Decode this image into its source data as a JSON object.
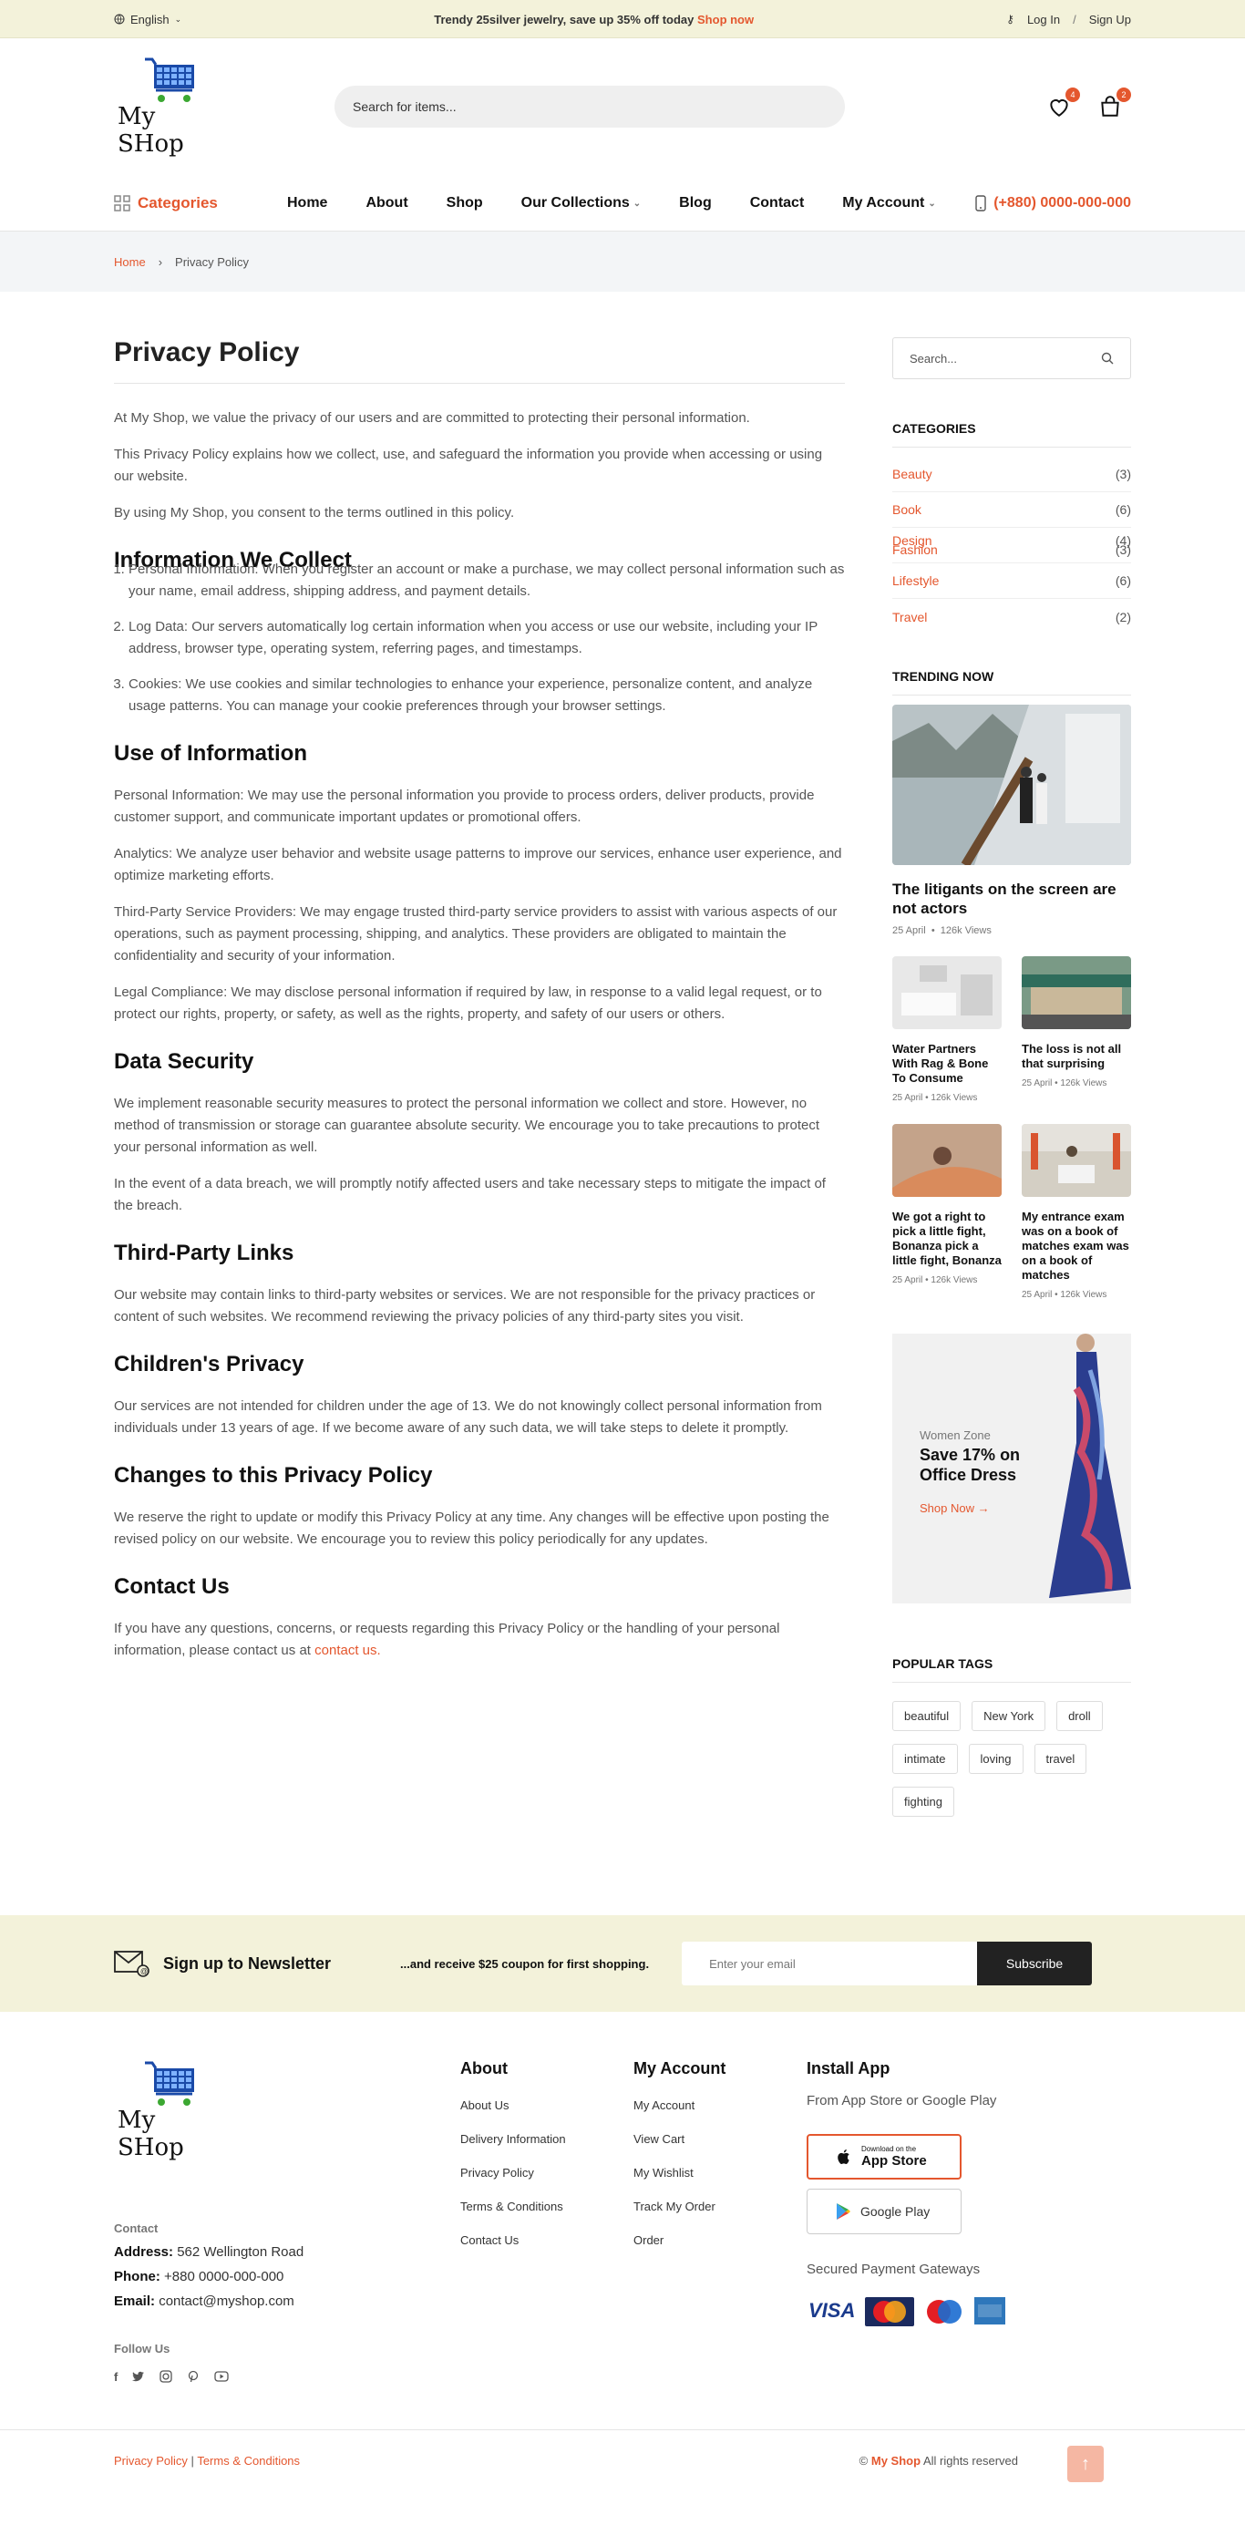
{
  "topbar": {
    "language": "English",
    "promo_text": "Trendy 25silver jewelry, save up 35% off today",
    "promo_link": "Shop now",
    "login": "Log In",
    "separator": "/",
    "signup": "Sign Up"
  },
  "header": {
    "brand": "My SHop",
    "search_placeholder": "Search for items...",
    "wishlist_count": "4",
    "cart_count": "2"
  },
  "nav": {
    "categories_label": "Categories",
    "items": [
      "Home",
      "About",
      "Shop",
      "Our Collections",
      "Blog",
      "Contact",
      "My Account"
    ],
    "phone": "(+880) 0000-000-000"
  },
  "breadcrumb": {
    "home": "Home",
    "sep": "›",
    "current": "Privacy Policy"
  },
  "content": {
    "title": "Privacy Policy",
    "intro": [
      "At My Shop, we value the privacy of our users and are committed to protecting their personal information.",
      "This Privacy Policy explains how we collect, use, and safeguard the information you provide when accessing or using our website.",
      "By using My Shop, you consent to the terms outlined in this policy."
    ],
    "collect_heading": "Information We Collect",
    "collect_items": [
      "Personal Information: When you register an account or make a purchase, we may collect personal information such as your name, email address, shipping address, and payment details.",
      "Log Data: Our servers automatically log certain information when you access or use our website, including your IP address, browser type, operating system, referring pages, and timestamps.",
      "Cookies: We use cookies and similar technologies to enhance your experience, personalize content, and analyze usage patterns. You can manage your cookie preferences through your browser settings."
    ],
    "use_heading": "Use of Information",
    "use_paras": [
      "Personal Information: We may use the personal information you provide to process orders, deliver products, provide customer support, and communicate important updates or promotional offers.",
      "Analytics: We analyze user behavior and website usage patterns to improve our services, enhance user experience, and optimize marketing efforts.",
      "Third-Party Service Providers: We may engage trusted third-party service providers to assist with various aspects of our operations, such as payment processing, shipping, and analytics. These providers are obligated to maintain the confidentiality and security of your information.",
      "Legal Compliance: We may disclose personal information if required by law, in response to a valid legal request, or to protect our rights, property, or safety, as well as the rights, property, and safety of our users or others."
    ],
    "security_heading": "Data Security",
    "security_paras": [
      "We implement reasonable security measures to protect the personal information we collect and store. However, no method of transmission or storage can guarantee absolute security. We encourage you to take precautions to protect your personal information as well.",
      "In the event of a data breach, we will promptly notify affected users and take necessary steps to mitigate the impact of the breach."
    ],
    "thirdparty_heading": "Third-Party Links",
    "thirdparty_para": "Our website may contain links to third-party websites or services. We are not responsible for the privacy practices or content of such websites. We recommend reviewing the privacy policies of any third-party sites you visit.",
    "children_heading": "Children's Privacy",
    "children_para": "Our services are not intended for children under the age of 13. We do not knowingly collect personal information from individuals under 13 years of age. If we become aware of any such data, we will take steps to delete it promptly.",
    "changes_heading": "Changes to this Privacy Policy",
    "changes_para": "We reserve the right to update or modify this Privacy Policy at any time. Any changes will be effective upon posting the revised policy on our website. We encourage you to review this policy periodically for any updates.",
    "contact_heading": "Contact Us",
    "contact_para": "If you have any questions, concerns, or requests regarding this Privacy Policy or the handling of your personal information, please contact us at",
    "contact_link": "contact us."
  },
  "sidebar": {
    "search_placeholder": "Search...",
    "categories_title": "CATEGORIES",
    "categories": [
      {
        "name": "Beauty",
        "count": "(3)"
      },
      {
        "name": "Book",
        "count": "(6)"
      },
      {
        "name": "Design",
        "count": "(4)"
      },
      {
        "name": "Fashion",
        "count": "(3)"
      },
      {
        "name": "Lifestyle",
        "count": "(6)"
      },
      {
        "name": "Travel",
        "count": "(2)"
      }
    ],
    "trending_title": "TRENDING NOW",
    "trending_main": {
      "title": "The litigants on the screen are not actors",
      "date": "25 April",
      "views": "126k Views"
    },
    "trending": [
      {
        "title": "Water Partners With Rag & Bone To Consume",
        "date": "25 April",
        "views": "126k Views"
      },
      {
        "title": "The loss is not all that surprising",
        "date": "25 April",
        "views": "126k Views"
      },
      {
        "title": "We got a right to pick a little fight, Bonanza pick a little fight, Bonanza",
        "date": "25 April",
        "views": "126k Views"
      },
      {
        "title": "My entrance exam was on a book of matches exam was on a book of matches",
        "date": "25 April",
        "views": "126k Views"
      }
    ],
    "promo": {
      "zone": "Women Zone",
      "offer": "Save 17% on Office Dress",
      "shop": "Shop Now"
    },
    "tags_title": "POPULAR TAGS",
    "tags": [
      "beautiful",
      "New York",
      "droll",
      "intimate",
      "loving",
      "travel",
      "fighting"
    ]
  },
  "newsletter": {
    "title": "Sign up to Newsletter",
    "subtitle": "...and receive $25 coupon for first shopping.",
    "placeholder": "Enter your email",
    "button": "Subscribe"
  },
  "footer": {
    "brand": "My SHop",
    "contact_label": "Contact",
    "address_label": "Address:",
    "address": "562 Wellington Road",
    "phone_label": "Phone:",
    "phone": "+880 0000-000-000",
    "email_label": "Email:",
    "email": "contact@myshop.com",
    "follow_label": "Follow Us",
    "about_title": "About",
    "about_links": [
      "About Us",
      "Delivery Information",
      "Privacy Policy",
      "Terms & Conditions",
      "Contact Us"
    ],
    "account_title": "My Account",
    "account_links": [
      "My Account",
      "View Cart",
      "My Wishlist",
      "Track My Order",
      "Order"
    ],
    "app_title": "Install App",
    "app_sub": "From App Store or Google Play",
    "appstore_small": "Download on the",
    "appstore_big": "App Store",
    "googleplay": "Google Play",
    "payment_title": "Secured Payment Gateways",
    "bottom_privacy": "Privacy Policy",
    "bottom_sep": "|",
    "bottom_terms": "Terms & Conditions",
    "copyright_sym": "©",
    "copyright_brand": "My Shop",
    "copyright_rest": "All rights reserved"
  },
  "colors": {
    "accent": "#e4572e",
    "topbar": "#f3f2da",
    "dark": "#222222"
  }
}
